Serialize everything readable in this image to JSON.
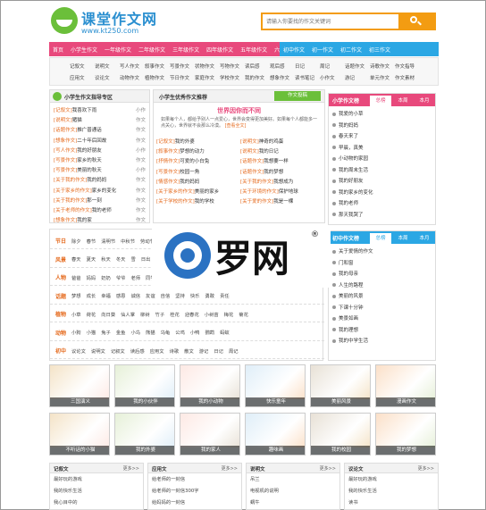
{
  "site": {
    "logo_title": "课堂作文网",
    "logo_url_text": "www.kt250.com"
  },
  "search": {
    "placeholder": "请输入你要找的作文关键词"
  },
  "nav": {
    "pink": [
      "首页",
      "小学生作文",
      "一年级作文",
      "二年级作文",
      "三年级作文",
      "四年级作文",
      "五年级作文",
      "六年级作文"
    ],
    "blue": [
      "初中作文",
      "初一作文",
      "初二作文",
      "初三作文"
    ]
  },
  "subnav": {
    "row1": [
      "记叙文",
      "说明文",
      "写人作文",
      "叙事作文",
      "写景作文",
      "状物作文",
      "写物作文",
      "读后感",
      "观后感",
      "日记",
      "周记",
      "话题作文",
      "诗歌作文",
      "作文指导"
    ],
    "row2": [
      "应用文",
      "议论文",
      "动物作文",
      "植物作文",
      "节日作文",
      "家庭作文",
      "学校作文",
      "我的作文",
      "想象作文",
      "读书笔记",
      "小作文",
      "游记",
      "单元作文",
      "作文素材"
    ]
  },
  "left_panel": {
    "title": "小学生作文指导专区",
    "items": [
      {
        "tag": "[记叙文]",
        "text": "我喜欢下雨",
        "meta": "小作"
      },
      {
        "tag": "[说明文]",
        "text": "猪猫",
        "meta": "作文"
      },
      {
        "tag": "[话题作文]",
        "text": "推广普通话",
        "meta": "作文"
      },
      {
        "tag": "[想象作文]",
        "text": "二十年后回故",
        "meta": "作文"
      },
      {
        "tag": "[写人作文]",
        "text": "我的好朋友",
        "meta": "小作"
      },
      {
        "tag": "[写景作文]",
        "text": "家乡的秋天",
        "meta": "作文"
      },
      {
        "tag": "[写景作文]",
        "text": "美丽的秋天",
        "meta": "小作"
      },
      {
        "tag": "[关于我的作文]",
        "text": "我的妈妈",
        "meta": "作文"
      },
      {
        "tag": "[关于家乡的作文]",
        "text": "家乡的变化",
        "meta": "作文"
      },
      {
        "tag": "[关于我的作文]",
        "text": "那一刻",
        "meta": "作文"
      },
      {
        "tag": "[关于老师的作文]",
        "text": "我的老师",
        "meta": "作文"
      },
      {
        "tag": "[想象作文]",
        "text": "我的家",
        "meta": "作文"
      }
    ]
  },
  "center_panel": {
    "title": "小学生优秀作文推荐",
    "button": "作文投稿",
    "headline": "世界因你而不同",
    "summary": "如果每个人，都给予别人一点爱心，世界会变得更加美好。如果每个人都能多一点关心，世界就不会那么冷漠。",
    "more": "[查看全文]",
    "items": [
      [
        "[记叙文]",
        "我的外婆",
        "[说明文]",
        "神奇的鸡蛋"
      ],
      [
        "[叙事作文]",
        "梦想的动力",
        "[说明文]",
        "我的日记"
      ],
      [
        "[抒情作文]",
        "可爱的小白兔",
        "[话题作文]",
        "我想要一样"
      ],
      [
        "[写景作文]",
        "校园一角",
        "[话题作文]",
        "我的梦想"
      ],
      [
        "[情感作文]",
        "我的妈妈",
        "[关于我的作文]",
        "我想成为"
      ],
      [
        "[关于家乡的作文]",
        "美丽的家乡",
        "[关于环境的作文]",
        "保护地球"
      ],
      [
        "[关于学校的作文]",
        "我的学校",
        "[关于爱的作文]",
        "我是一棵"
      ]
    ]
  },
  "right_top": {
    "title": "小学作文榜",
    "tabs": [
      "总榜",
      "本周",
      "本月"
    ],
    "items": [
      "我爱的小草",
      "我的妈妈",
      "春天来了",
      "早晨，真美",
      "小动物的家园",
      "我的周末生活",
      "我的好朋友",
      "我的家乡的变化",
      "我的老师",
      "那天我哭了"
    ]
  },
  "right_mid": {
    "title": "初中作文榜",
    "tabs": [
      "总榜",
      "本周",
      "本月"
    ],
    "items": [
      "关于爱情的作文",
      "门和窗",
      "我的母亲",
      "人生的路程",
      "美丽的风景",
      "下课十分钟",
      "美景如画",
      "我的理想",
      "我的中学生活"
    ]
  },
  "categories": [
    {
      "name": "节日",
      "words": [
        "除夕",
        "春节",
        "清明节",
        "中秋节",
        "劳动节",
        "端午节",
        "元宵节",
        "圣诞节",
        "国庆节"
      ]
    },
    {
      "name": "风景",
      "words": [
        "春天",
        "夏天",
        "秋天",
        "冬天",
        "雪",
        "日出",
        "大海",
        "森林",
        "校园",
        "公园",
        "家乡"
      ]
    },
    {
      "name": "人物",
      "words": [
        "爸爸",
        "妈妈",
        "奶奶",
        "爷爷",
        "老师",
        "同学",
        "朋友",
        "哥哥",
        "姐姐"
      ]
    },
    {
      "name": "话题",
      "words": [
        "梦想",
        "成长",
        "幸福",
        "感恩",
        "诚信",
        "友谊",
        "自信",
        "坚持",
        "快乐",
        "勇敢",
        "责任"
      ]
    },
    {
      "name": "植物",
      "words": [
        "小草",
        "荷花",
        "向日葵",
        "仙人掌",
        "柳树",
        "竹子",
        "桂花",
        "迎春花",
        "小树苗",
        "梅花",
        "菊花"
      ]
    },
    {
      "name": "动物",
      "words": [
        "小狗",
        "小猫",
        "兔子",
        "金鱼",
        "小鸟",
        "熊猫",
        "乌龟",
        "公鸡",
        "小鸭",
        "鹦鹉",
        "蚂蚁"
      ]
    },
    {
      "name": "初中",
      "words": [
        "议论文",
        "说明文",
        "记叙文",
        "读后感",
        "应用文",
        "诗歌",
        "散文",
        "游记",
        "日记",
        "周记"
      ]
    }
  ],
  "thumbs_row1": [
    "三国演义",
    "我的小伙伴",
    "我的小动物",
    "快乐童年",
    "美丽风景",
    "漫画作文"
  ],
  "thumbs_row2": [
    "不听话的小猫",
    "我的外婆",
    "我的家人",
    "趣味画",
    "我的校园",
    "我的梦想"
  ],
  "bottom": [
    {
      "title": "记叙文",
      "more": "更多>>",
      "items": [
        "最好玩的游戏",
        "我的快乐生活",
        "我心目中的"
      ]
    },
    {
      "title": "应用文",
      "more": "更多>>",
      "items": [
        "给老师的一封信",
        "给老师的一封信300字",
        "给妈妈的一封信"
      ]
    },
    {
      "title": "说明文",
      "more": "更多>>",
      "items": [
        "吊兰",
        "电视机的说明",
        "蜗牛"
      ]
    },
    {
      "title": "议论文",
      "more": "更多>>",
      "items": [
        "最好玩的游戏",
        "我的快乐生活",
        "读书"
      ]
    }
  ],
  "watermark": {
    "text": "罗网",
    "reg": "®"
  },
  "colors": {
    "pink": "#e8497c",
    "blue": "#2ba7e4",
    "orange": "#f39c12",
    "green": "#6bbf3a"
  }
}
